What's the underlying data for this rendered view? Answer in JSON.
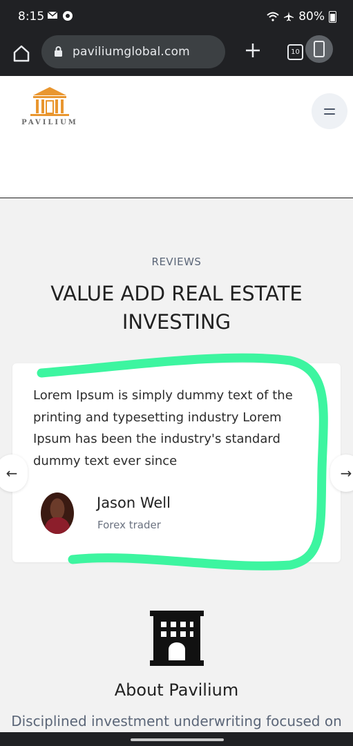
{
  "status_bar": {
    "time": "8:15",
    "battery": "80%",
    "icons": [
      "mail-icon",
      "chrome-icon",
      "wifi-icon",
      "airplane-icon",
      "battery-icon"
    ]
  },
  "browser": {
    "url": "paviliumglobal.com",
    "tab_count": "10"
  },
  "site": {
    "logo_text": "PAVILIUM",
    "accent_color": "#e9962f"
  },
  "reviews": {
    "eyebrow": "REVIEWS",
    "heading": "VALUE ADD REAL ESTATE INVESTING",
    "quote": "Lorem Ipsum is simply dummy text of the printing and typesetting industry Lorem Ipsum has been the industry's standard dummy text ever since",
    "author_name": "Jason Well",
    "author_role": "Forex trader",
    "prev_arrow": "←",
    "next_arrow": "→",
    "highlight_color": "#3df5a0"
  },
  "about": {
    "title": "About Pavilium",
    "text": "Disciplined investment underwriting focused on"
  }
}
